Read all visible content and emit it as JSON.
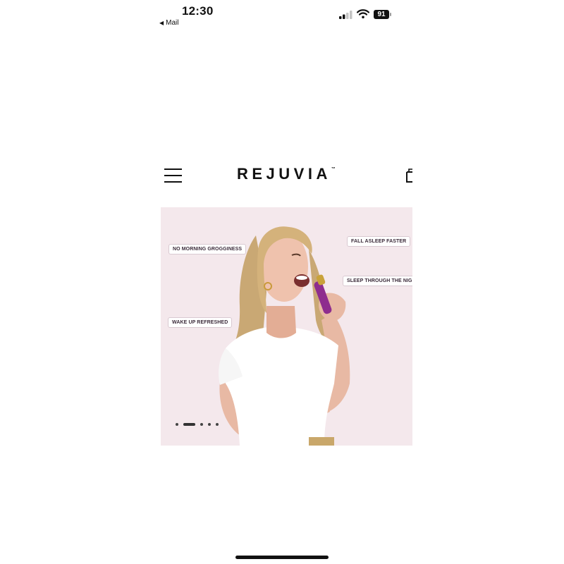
{
  "status_bar": {
    "time": "12:30",
    "back_label": "Mail",
    "back_icon": "back-triangle-icon",
    "battery_level": "91",
    "signal_bars_active": 2,
    "signal_bars_total": 4
  },
  "header": {
    "brand": "REJUVIA",
    "trademark": "™",
    "menu_icon": "hamburger-menu-icon",
    "cart_icon": "shopping-bag-icon"
  },
  "hero": {
    "background_color": "#f4e8ec",
    "tags": {
      "no_grogginess": "NO MORNING GROGGINESS",
      "fall_asleep": "FALL ASLEEP FASTER",
      "sleep_through": "SLEEP THROUGH THE NIGHT",
      "wake_up": "WAKE UP REFRESHED"
    },
    "carousel": {
      "total_slides": 5,
      "active_slide": 2
    }
  }
}
